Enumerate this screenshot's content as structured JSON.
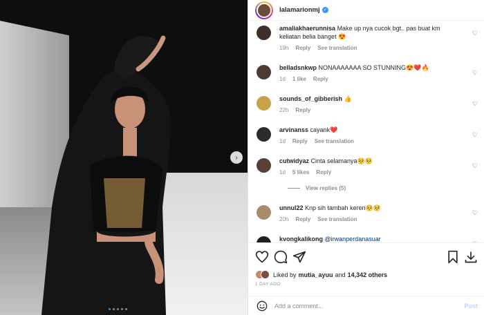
{
  "post": {
    "username": "lalamarionmj",
    "verified_icon": "verified-badge-icon",
    "carousel": {
      "slides": 5,
      "active": 1,
      "next_icon": "chevron-right-icon"
    }
  },
  "comments": [
    {
      "user": "amaliakhaerunnisa",
      "text": "Make up nya cucok bgt.. pas buat km keliatan belia banget 😍",
      "time": "19h",
      "actions": [
        "Reply",
        "See translation"
      ],
      "avatar_color": "#3b2f2a"
    },
    {
      "user": "belladsnkwp",
      "text": "NONAAAAAAA SO STUNNING😍❤️🔥",
      "time": "1d",
      "likes": "1 like",
      "actions": [
        "Reply"
      ],
      "avatar_color": "#4c3a35"
    },
    {
      "user": "sounds_of_gibberish",
      "text": "👍",
      "time": "22h",
      "actions": [
        "Reply"
      ],
      "avatar_color": "#c7a24b"
    },
    {
      "user": "arvinanss",
      "text": "cayank❤️",
      "time": "1d",
      "actions": [
        "Reply",
        "See translation"
      ],
      "avatar_color": "#2b2b2b"
    },
    {
      "user": "cutwidyaz",
      "text": "Cinta selamanya🥺🥺",
      "time": "1d",
      "likes": "5 likes",
      "actions": [
        "Reply"
      ],
      "avatar_color": "#5a3f36"
    },
    {
      "view_replies": "View replies (5)"
    },
    {
      "user": "unnul22",
      "text": "Knp sih tambah keren🥺🥺",
      "time": "20h",
      "actions": [
        "Reply",
        "See translation"
      ],
      "avatar_color": "#a88c6a"
    },
    {
      "user": "kvongkalikong",
      "mention": "@irwanperdanasuar",
      "avatar_color": "#1f1f1f"
    }
  ],
  "actions": {
    "like_icon": "heart-outline-icon",
    "comment_icon": "comment-bubble-icon",
    "share_icon": "paper-plane-icon",
    "save_icon": "bookmark-icon",
    "download_icon": "download-icon",
    "liked_by_prefix": "Liked by",
    "liked_by_user": "mutia_ayuu",
    "liked_by_and": "and",
    "liked_by_count": "14,342 others",
    "timestamp": "1 DAY AGO"
  },
  "composer": {
    "emoji_icon": "smiley-icon",
    "placeholder": "Add a comment...",
    "post_label": "Post"
  }
}
